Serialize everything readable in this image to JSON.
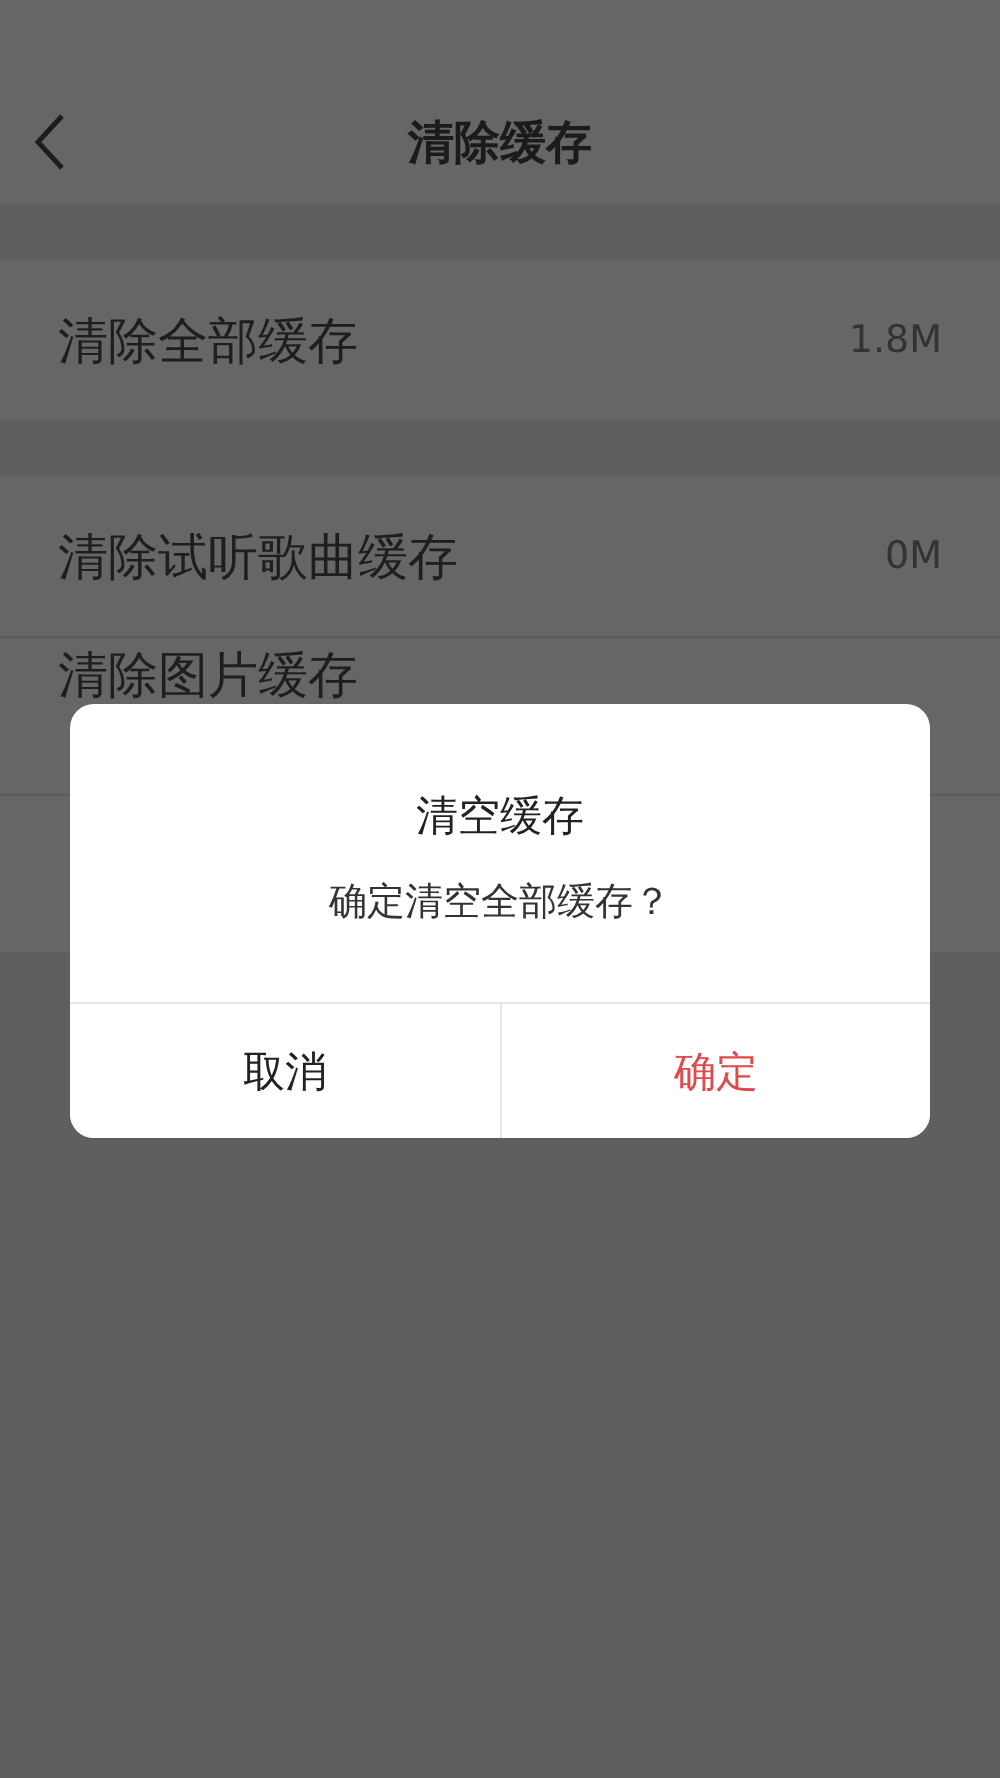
{
  "header": {
    "title": "清除缓存"
  },
  "groups": [
    {
      "rows": [
        {
          "label": "清除全部缓存",
          "value": "1.8M"
        }
      ]
    },
    {
      "rows": [
        {
          "label": "清除试听歌曲缓存",
          "value": "0M"
        },
        {
          "label": "清除图片缓存"
        },
        {}
      ]
    }
  ],
  "dialog": {
    "title": "清空缓存",
    "message": "确定清空全部缓存？",
    "buttons": [
      {
        "label": "取消",
        "kind": "cancel"
      },
      {
        "label": "确定",
        "kind": "confirm"
      }
    ]
  }
}
